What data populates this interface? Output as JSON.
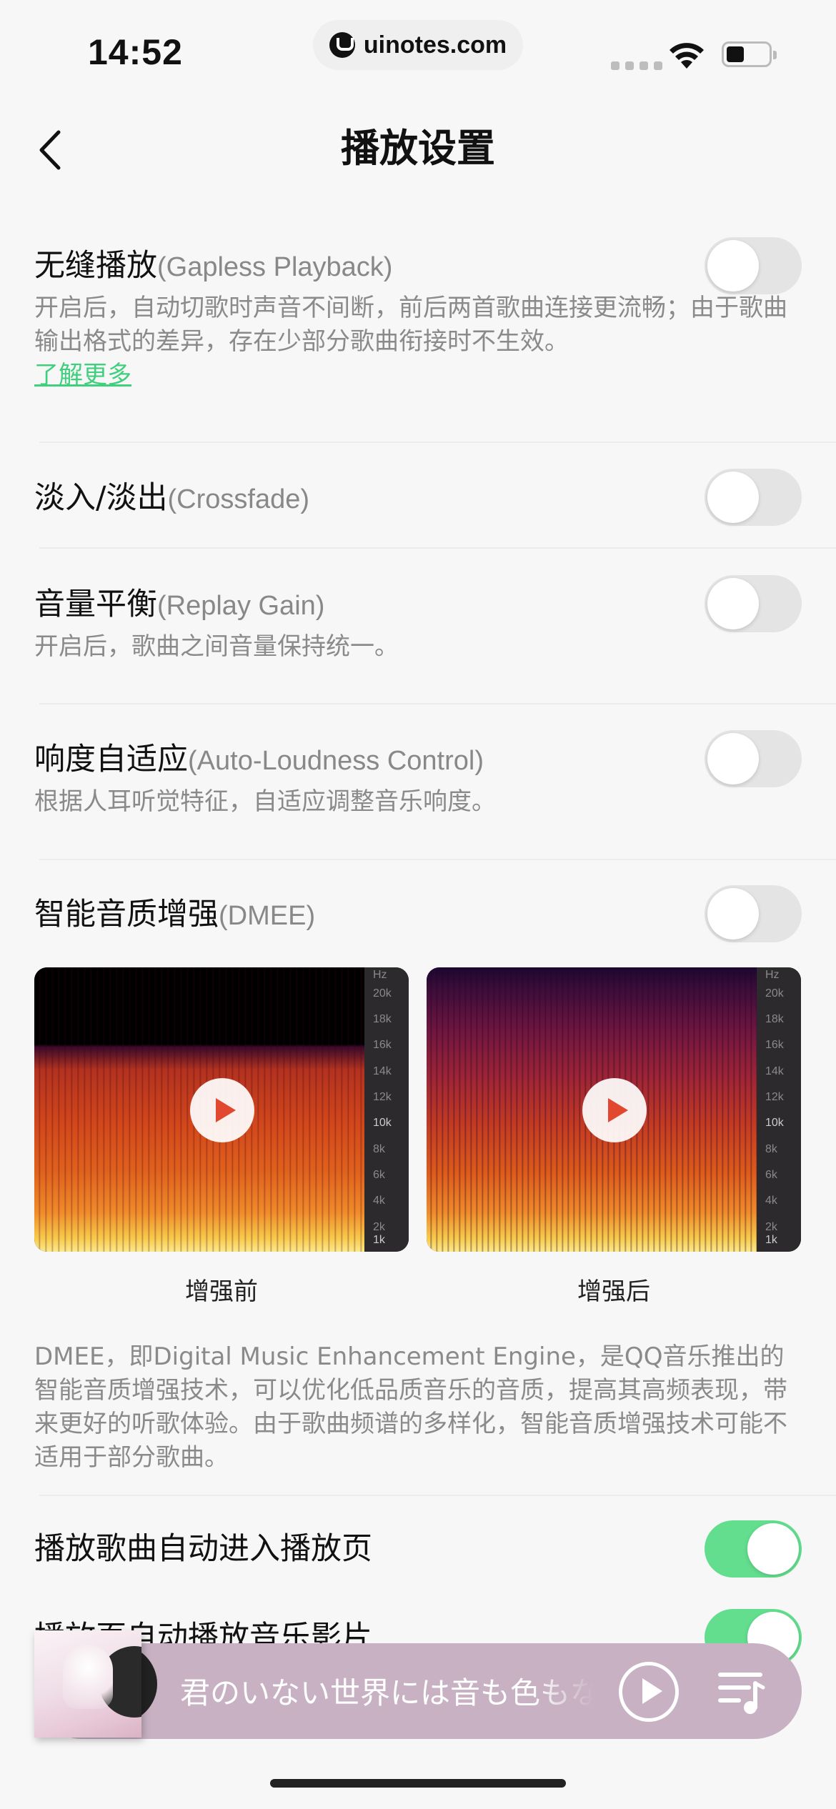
{
  "status_bar": {
    "time": "14:52",
    "url": "uinotes.com"
  },
  "header": {
    "title": "播放设置"
  },
  "settings": [
    {
      "title": "无缝播放",
      "title_en": "(Gapless Playback)",
      "description": "开启后，自动切歌时声音不间断，前后两首歌曲连接更流畅；由于歌曲输出格式的差异，存在少部分歌曲衔接时不生效。",
      "link": "了解更多",
      "enabled": false
    },
    {
      "title": "淡入/淡出",
      "title_en": "(Crossfade)",
      "enabled": false
    },
    {
      "title": "音量平衡",
      "title_en": "(Replay Gain)",
      "description": "开启后，歌曲之间音量保持统一。",
      "enabled": false
    },
    {
      "title": "响度自适应",
      "title_en": "(Auto-Loudness Control)",
      "description": "根据人耳听觉特征，自适应调整音乐响度。",
      "enabled": false
    },
    {
      "title": "智能音质增强",
      "title_en": "(DMEE)",
      "description": "DMEE，即Digital Music Enhancement Engine，是QQ音乐推出的智能音质增强技术，可以优化低品质音乐的音质，提高其高频表现，带来更好的听歌体验。由于歌曲频谱的多样化，智能音质增强技术可能不适用于部分歌曲。",
      "enabled": false
    },
    {
      "title": "播放歌曲自动进入播放页",
      "enabled": true
    },
    {
      "title": "播放页自动播放音乐影片",
      "enabled": true
    }
  ],
  "dmee_samples": {
    "before_label": "增强前",
    "after_label": "增强后",
    "axis_unit": "Hz",
    "axis_ticks": [
      "20k",
      "18k",
      "16k",
      "14k",
      "12k",
      "10k",
      "8k",
      "6k",
      "4k",
      "2k",
      "1k"
    ]
  },
  "player": {
    "song_title": "君のいない世界には音も色もない"
  },
  "colors": {
    "accent_green": "#63dd8e",
    "link_green": "#3fcf7d",
    "player_bg": "#c7b1c3"
  }
}
